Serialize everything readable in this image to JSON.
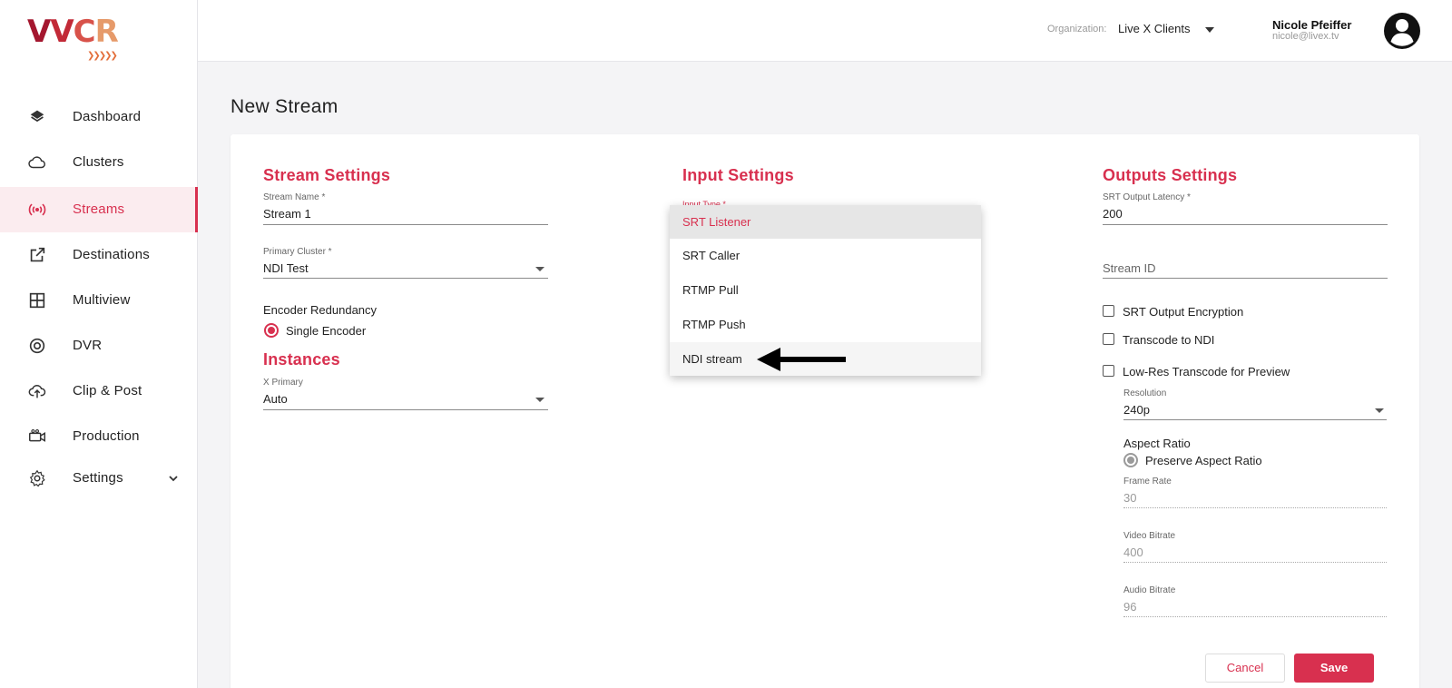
{
  "logo": {
    "text_v1": "V",
    "text_v2": "V",
    "text_c": "C",
    "text_r": "R"
  },
  "sidebar": {
    "items": [
      {
        "label": "Dashboard",
        "icon": "layers-icon"
      },
      {
        "label": "Clusters",
        "icon": "cloud-icon"
      },
      {
        "label": "Streams",
        "icon": "broadcast-icon",
        "active": true
      },
      {
        "label": "Destinations",
        "icon": "external-link-icon"
      },
      {
        "label": "Multiview",
        "icon": "grid-icon"
      },
      {
        "label": "DVR",
        "icon": "record-icon"
      },
      {
        "label": "Clip & Post",
        "icon": "cloud-upload-icon"
      },
      {
        "label": "Production",
        "icon": "video-camera-icon"
      },
      {
        "label": "Settings",
        "icon": "gear-icon"
      }
    ]
  },
  "header": {
    "org_label": "Organization:",
    "org_value": "Live X Clients",
    "user_name": "Nicole Pfeiffer",
    "user_email": "nicole@livex.tv"
  },
  "page": {
    "title": "New Stream"
  },
  "stream_settings": {
    "title": "Stream Settings",
    "stream_name_label": "Stream Name *",
    "stream_name_value": "Stream 1",
    "primary_cluster_label": "Primary Cluster *",
    "primary_cluster_value": "NDI Test",
    "encoder_redundancy_label": "Encoder Redundancy",
    "encoder_option": "Single Encoder"
  },
  "instances": {
    "title": "Instances",
    "x_primary_label": "X Primary",
    "x_primary_value": "Auto"
  },
  "input_settings": {
    "title": "Input Settings",
    "input_type_label_partial": "Input Type *",
    "dropdown_options": [
      "SRT Listener",
      "SRT Caller",
      "RTMP Pull",
      "RTMP Push",
      "NDI stream"
    ],
    "selected": "SRT Listener",
    "hovered": "NDI stream"
  },
  "outputs_settings": {
    "title": "Outputs Settings",
    "srt_latency_label": "SRT Output Latency *",
    "srt_latency_value": "200",
    "stream_id_placeholder": "Stream ID",
    "srt_encryption_label": "SRT Output Encryption",
    "transcode_ndi_label": "Transcode to NDI",
    "low_res_label": "Low-Res Transcode for Preview",
    "resolution_label": "Resolution",
    "resolution_value": "240p",
    "aspect_ratio_label": "Aspect Ratio",
    "aspect_ratio_option": "Preserve Aspect Ratio",
    "frame_rate_label": "Frame Rate",
    "frame_rate_value": "30",
    "video_bitrate_label": "Video Bitrate",
    "video_bitrate_value": "400",
    "audio_bitrate_label": "Audio Bitrate",
    "audio_bitrate_value": "96"
  },
  "actions": {
    "cancel": "Cancel",
    "save": "Save"
  },
  "colors": {
    "accent": "#d8304f",
    "active_bg": "#fbecef"
  }
}
